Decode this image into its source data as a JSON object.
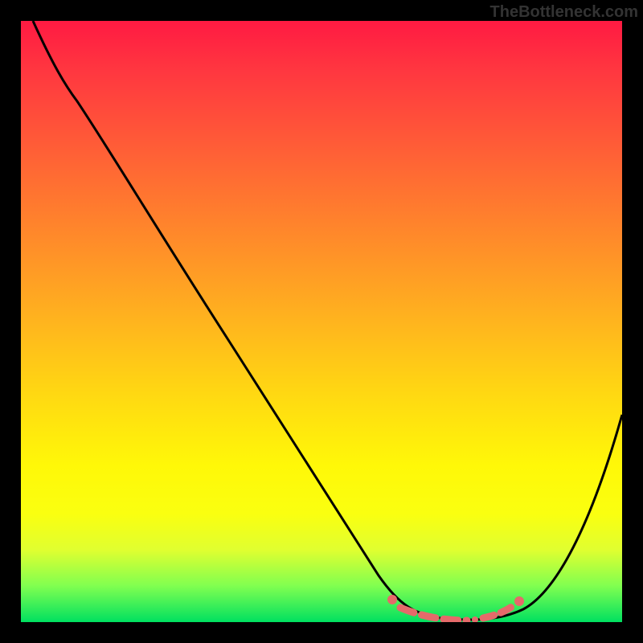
{
  "watermark": "TheBottleneck.com",
  "chart_data": {
    "type": "line",
    "title": "",
    "xlabel": "",
    "ylabel": "",
    "xlim": [
      0,
      100
    ],
    "ylim": [
      0,
      100
    ],
    "series": [
      {
        "name": "bottleneck-curve",
        "color": "#000000",
        "points": [
          {
            "x": 2,
            "y": 100
          },
          {
            "x": 9,
            "y": 90
          },
          {
            "x": 20,
            "y": 73
          },
          {
            "x": 30,
            "y": 58
          },
          {
            "x": 40,
            "y": 42
          },
          {
            "x": 50,
            "y": 26
          },
          {
            "x": 57,
            "y": 11
          },
          {
            "x": 61,
            "y": 4
          },
          {
            "x": 66,
            "y": 1
          },
          {
            "x": 74,
            "y": 0.5
          },
          {
            "x": 80,
            "y": 1
          },
          {
            "x": 84,
            "y": 4
          },
          {
            "x": 90,
            "y": 14
          },
          {
            "x": 100,
            "y": 35
          }
        ]
      }
    ],
    "markers": [
      {
        "name": "marker-band",
        "color": "#e56a6a",
        "x_from": 62,
        "x_to": 82,
        "y": 2
      }
    ],
    "background": {
      "type": "vertical-gradient",
      "stops": [
        {
          "pos": 0,
          "color": "#ff1a42"
        },
        {
          "pos": 50,
          "color": "#ffb41e"
        },
        {
          "pos": 80,
          "color": "#fff808"
        },
        {
          "pos": 100,
          "color": "#00e060"
        }
      ]
    }
  }
}
